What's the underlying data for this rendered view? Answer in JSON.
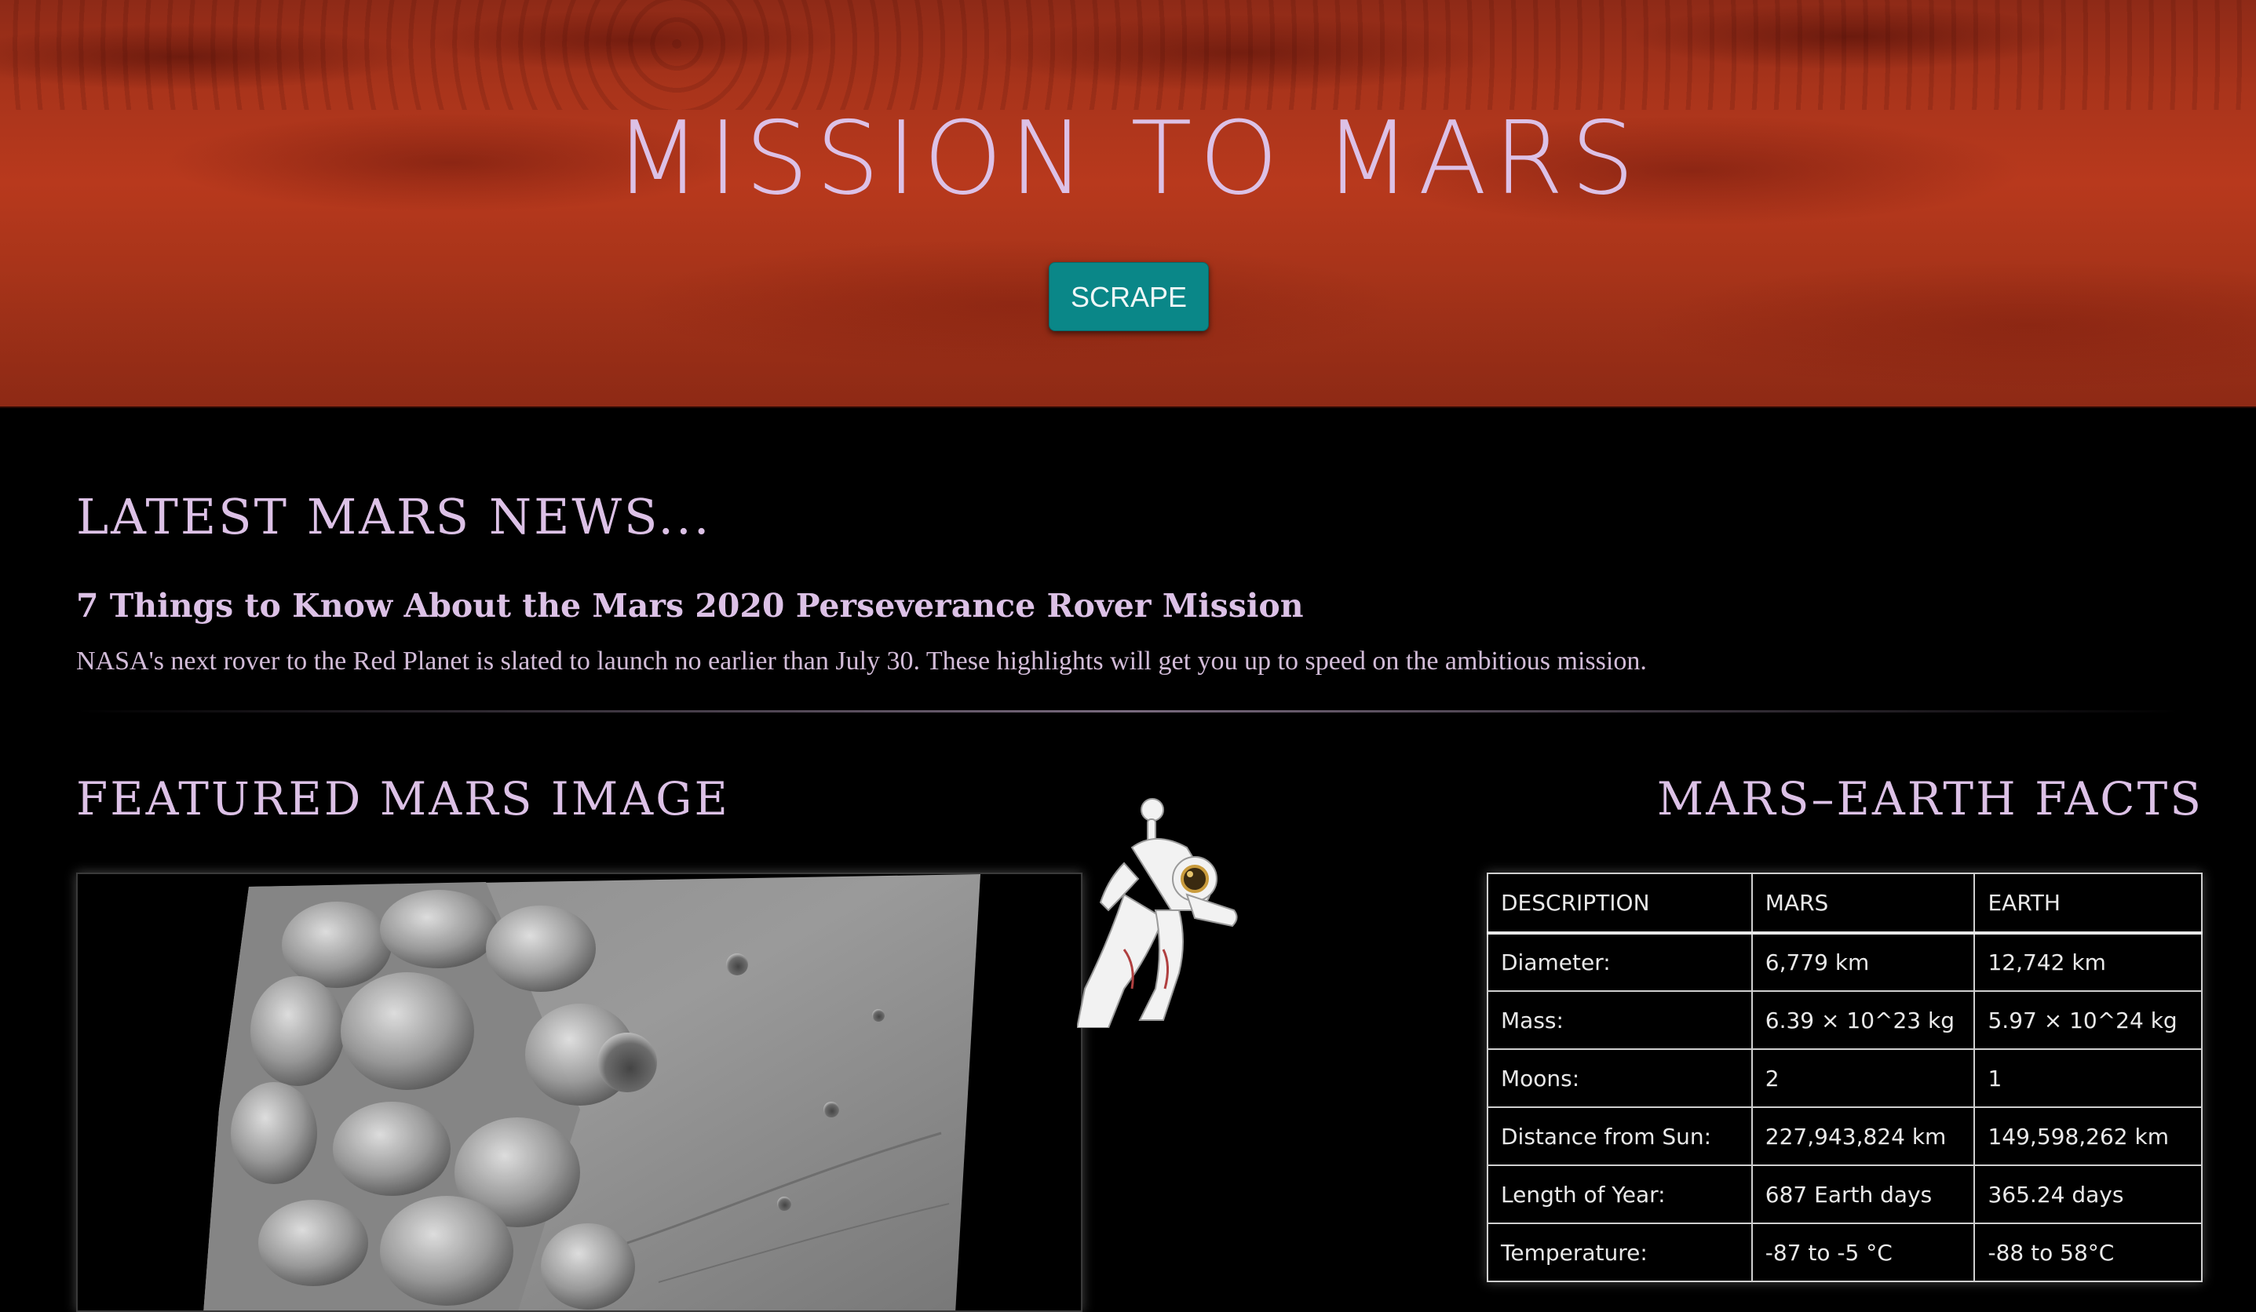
{
  "header": {
    "title": "MISSION TO MARS",
    "scrape_label": "SCRAPE"
  },
  "news": {
    "heading": "LATEST MARS NEWS...",
    "title": "7 Things to Know About the Mars 2020 Perseverance Rover Mission",
    "teaser": "NASA's next rover to the Red Planet is slated to launch no earlier than July 30. These highlights will get you up to speed on the ambitious mission."
  },
  "featured": {
    "heading": "FEATURED MARS IMAGE"
  },
  "facts": {
    "heading": "MARS–EARTH FACTS",
    "columns": [
      "DESCRIPTION",
      "MARS",
      "EARTH"
    ],
    "rows": [
      [
        "Diameter:",
        "6,779 km",
        "12,742 km"
      ],
      [
        "Mass:",
        "6.39 × 10^23 kg",
        "5.97 × 10^24 kg"
      ],
      [
        "Moons:",
        "2",
        "1"
      ],
      [
        "Distance from Sun:",
        "227,943,824 km",
        "149,598,262 km"
      ],
      [
        "Length of Year:",
        "687 Earth days",
        "365.24 days"
      ],
      [
        "Temperature:",
        "-87 to -5 °C",
        "-88 to 58°C"
      ]
    ]
  },
  "colors": {
    "accent_text": "#dcc1e6",
    "button": "#0a8788",
    "background": "#000000",
    "hero": "#a9341b"
  },
  "icons": {
    "astronaut": "astronaut-icon"
  }
}
